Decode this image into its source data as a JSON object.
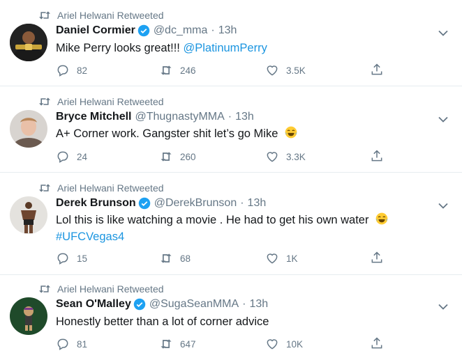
{
  "tweets": [
    {
      "retweeted_by": "Ariel Helwani Retweeted",
      "display_name": "Daniel Cormier",
      "verified": true,
      "handle": "@dc_mma",
      "separator": "·",
      "time": "13h",
      "text_lines": [
        {
          "plain": "Mike Perry looks great!!! ",
          "link": "@PlatinumPerry"
        }
      ],
      "emoji": "",
      "reply_count": "82",
      "retweet_count": "246",
      "like_count": "3.5K"
    },
    {
      "retweeted_by": "Ariel Helwani Retweeted",
      "display_name": "Bryce Mitchell",
      "verified": false,
      "handle": "@ThugnastyMMA",
      "separator": "·",
      "time": "13h",
      "text_lines": [
        {
          "plain": "A+ Corner work. Gangster shit let’s go Mike",
          "link": ""
        }
      ],
      "emoji": "tears-of-joy",
      "reply_count": "24",
      "retweet_count": "260",
      "like_count": "3.3K"
    },
    {
      "retweeted_by": "Ariel Helwani Retweeted",
      "display_name": "Derek Brunson",
      "verified": true,
      "handle": "@DerekBrunson",
      "separator": "·",
      "time": "13h",
      "text_lines": [
        {
          "plain": "Lol this is like watching a movie . He had to get his own water",
          "link": ""
        },
        {
          "plain": "",
          "link": "#UFCVegas4"
        }
      ],
      "emoji": "tears-of-joy",
      "reply_count": "15",
      "retweet_count": "68",
      "like_count": "1K"
    },
    {
      "retweeted_by": "Ariel Helwani Retweeted",
      "display_name": "Sean O'Malley",
      "verified": true,
      "handle": "@SugaSeanMMA",
      "separator": "·",
      "time": "13h",
      "text_lines": [
        {
          "plain": "Honestly better than a lot of corner advice",
          "link": ""
        }
      ],
      "emoji": "",
      "reply_count": "81",
      "retweet_count": "647",
      "like_count": "10K"
    }
  ],
  "icons": {
    "retweet": "retweet-icon",
    "reply": "reply-icon",
    "like": "heart-icon",
    "share": "share-icon",
    "verified": "verified-badge-icon",
    "caret": "chevron-down-icon"
  },
  "colors": {
    "text": "#14171a",
    "secondary": "#657786",
    "link": "#1b95e0",
    "verified": "#1da1f2",
    "divider": "#e6ecf0"
  }
}
